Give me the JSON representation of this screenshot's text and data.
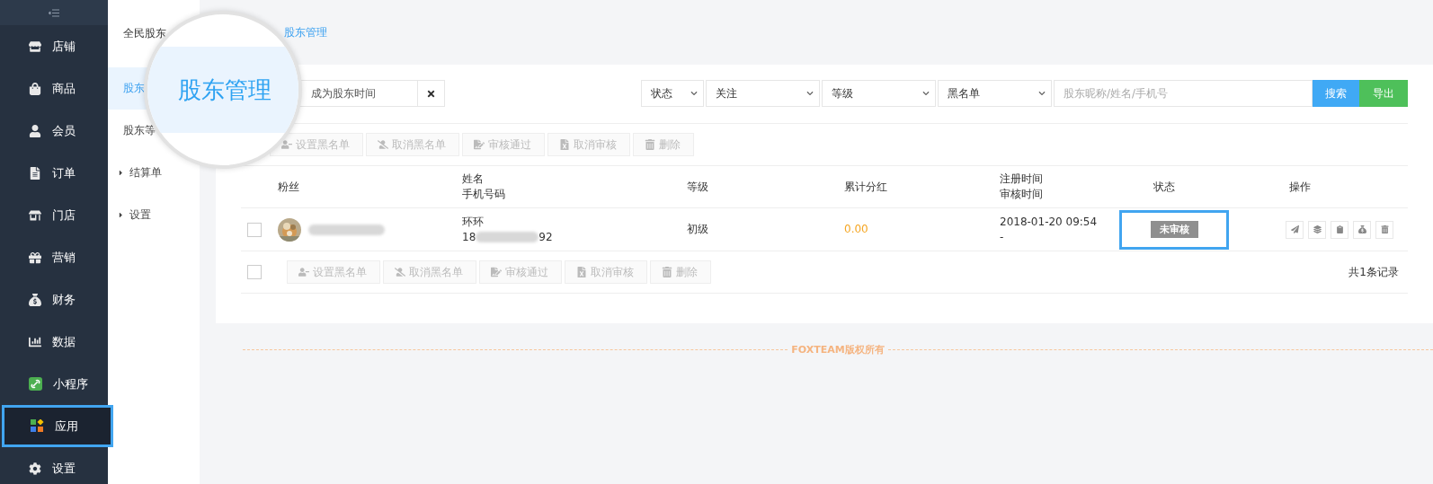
{
  "sidebar": {
    "items": [
      {
        "label": "店铺",
        "selected": false,
        "highlighted": false
      },
      {
        "label": "商品",
        "selected": false,
        "highlighted": false
      },
      {
        "label": "会员",
        "selected": false,
        "highlighted": false
      },
      {
        "label": "订单",
        "selected": false,
        "highlighted": false
      },
      {
        "label": "门店",
        "selected": false,
        "highlighted": false
      },
      {
        "label": "营销",
        "selected": false,
        "highlighted": false
      },
      {
        "label": "财务",
        "selected": false,
        "highlighted": false
      },
      {
        "label": "数据",
        "selected": false,
        "highlighted": false
      },
      {
        "label": "小程序",
        "selected": false,
        "highlighted": false
      },
      {
        "label": "应用",
        "selected": true,
        "highlighted": true
      },
      {
        "label": "设置",
        "selected": false,
        "highlighted": false
      }
    ]
  },
  "subnav": {
    "title": "全民股东",
    "items": [
      {
        "label": "股东",
        "selected": true,
        "expandable": false
      },
      {
        "label": "股东等",
        "selected": false,
        "expandable": false
      },
      {
        "label": "结算单",
        "selected": false,
        "expandable": true
      },
      {
        "label": "设置",
        "selected": false,
        "expandable": true
      }
    ]
  },
  "breadcrumb": "股东管理",
  "magnifier": {
    "text": "股东管理"
  },
  "filters": {
    "date_field": {
      "placeholder": "成为股东时间"
    },
    "selects": [
      "状态",
      "关注",
      "等级",
      "黑名单"
    ],
    "search": {
      "placeholder": "股东昵称/姓名/手机号"
    },
    "buttons": [
      {
        "label": "搜索",
        "kind": "primary"
      },
      {
        "label": "导出",
        "kind": "success"
      }
    ]
  },
  "bulk_actions": [
    "设置黑名单",
    "取消黑名单",
    "审核通过",
    "取消审核",
    "删除"
  ],
  "table": {
    "columns": [
      [
        "粉丝"
      ],
      [
        "姓名",
        "手机号码"
      ],
      [
        "等级"
      ],
      [
        "累计分红"
      ],
      [
        "注册时间",
        "审核时间"
      ],
      [
        "状态"
      ],
      [
        "操作"
      ]
    ],
    "rows": [
      {
        "checked": false,
        "name": "环环",
        "phone_prefix": "18",
        "phone_suffix": "92",
        "grade": "初级",
        "dividend": "0.00",
        "registered": "2018-01-20 09:54",
        "reviewed": "-",
        "status": "未审核",
        "status_highlighted": true
      }
    ]
  },
  "footer": {
    "checked": false,
    "bulk_actions": [
      "设置黑名单",
      "取消黑名单",
      "审核通过",
      "取消审核",
      "删除"
    ],
    "record_count": "共1条记录"
  },
  "copyright": "FOXTEAM版权所有"
}
